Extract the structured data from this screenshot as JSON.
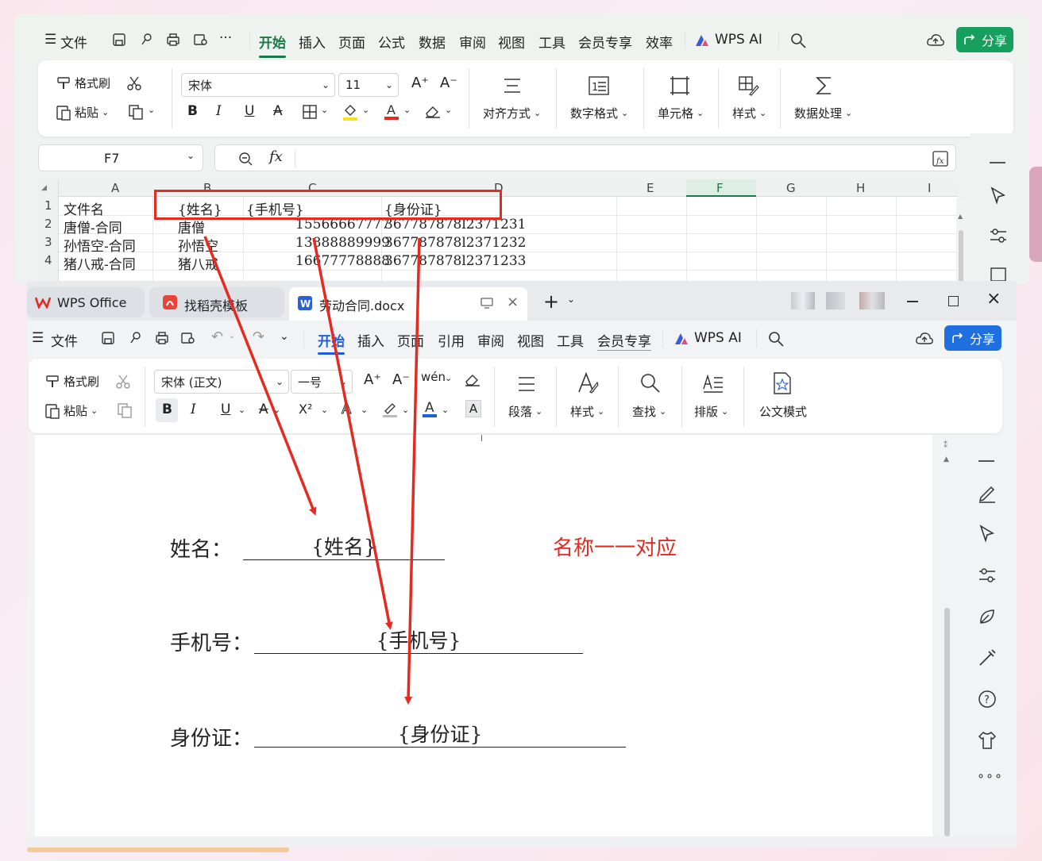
{
  "excel": {
    "menu": {
      "file": "文件",
      "more": "···"
    },
    "tabs": [
      "开始",
      "插入",
      "页面",
      "公式",
      "数据",
      "审阅",
      "视图",
      "工具",
      "会员专享",
      "效率"
    ],
    "active_tab": "开始",
    "wps_ai": "WPS AI",
    "share": "分享",
    "ribbon": {
      "format_painter": "格式刷",
      "paste": "粘贴",
      "font_name": "宋体",
      "font_size": "11",
      "bold": "B",
      "italic": "I",
      "underline": "U",
      "strike": "A",
      "align": "对齐方式",
      "number_format": "数字格式",
      "cell": "单元格",
      "style": "样式",
      "data_process": "数据处理"
    },
    "name_box": "F7",
    "fx": "fx",
    "columns": [
      "A",
      "B",
      "C",
      "D",
      "E",
      "F",
      "G",
      "H",
      "I"
    ],
    "rows": [
      {
        "num": "1",
        "a": "文件名",
        "b": "{姓名}",
        "c": "{手机号}",
        "d": "{身份证}"
      },
      {
        "num": "2",
        "a": "唐僧-合同",
        "b": "唐僧",
        "c": "15566667777",
        "d": "367787878l2371231"
      },
      {
        "num": "3",
        "a": "孙悟空-合同",
        "b": "孙悟空",
        "c": "13888889999",
        "d": "367787878l2371232"
      },
      {
        "num": "4",
        "a": "猪八戒-合同",
        "b": "猪八戒",
        "c": "16677778888",
        "d": "367787878l2371233"
      }
    ]
  },
  "word": {
    "tabs_bar": [
      {
        "label": "WPS Office"
      },
      {
        "label": "找稻壳模板"
      },
      {
        "label": "劳动合同.docx"
      }
    ],
    "menu": {
      "file": "文件"
    },
    "tabs": [
      "开始",
      "插入",
      "页面",
      "引用",
      "审阅",
      "视图",
      "工具",
      "会员专享"
    ],
    "active_tab": "开始",
    "wps_ai": "WPS AI",
    "share": "分享",
    "ribbon": {
      "format_painter": "格式刷",
      "paste": "粘贴",
      "font_name": "宋体 (正文)",
      "font_size": "一号",
      "bold": "B",
      "italic": "I",
      "underline": "U",
      "superscript": "X²",
      "paragraph": "段落",
      "style": "样式",
      "find": "查找",
      "layout": "排版",
      "official": "公文模式"
    },
    "doc": {
      "name_label": "姓名：",
      "name_field": "{姓名}",
      "phone_label": "手机号：",
      "phone_field": "{手机号}",
      "id_label": "身份证：",
      "id_field": "{身份证}",
      "annotation": "名称一一对应"
    }
  },
  "colors": {
    "excel_green": "#1a7a45",
    "share_green": "#17a05d",
    "word_blue": "#1f5fd6",
    "annotation_red": "#e32b22"
  }
}
